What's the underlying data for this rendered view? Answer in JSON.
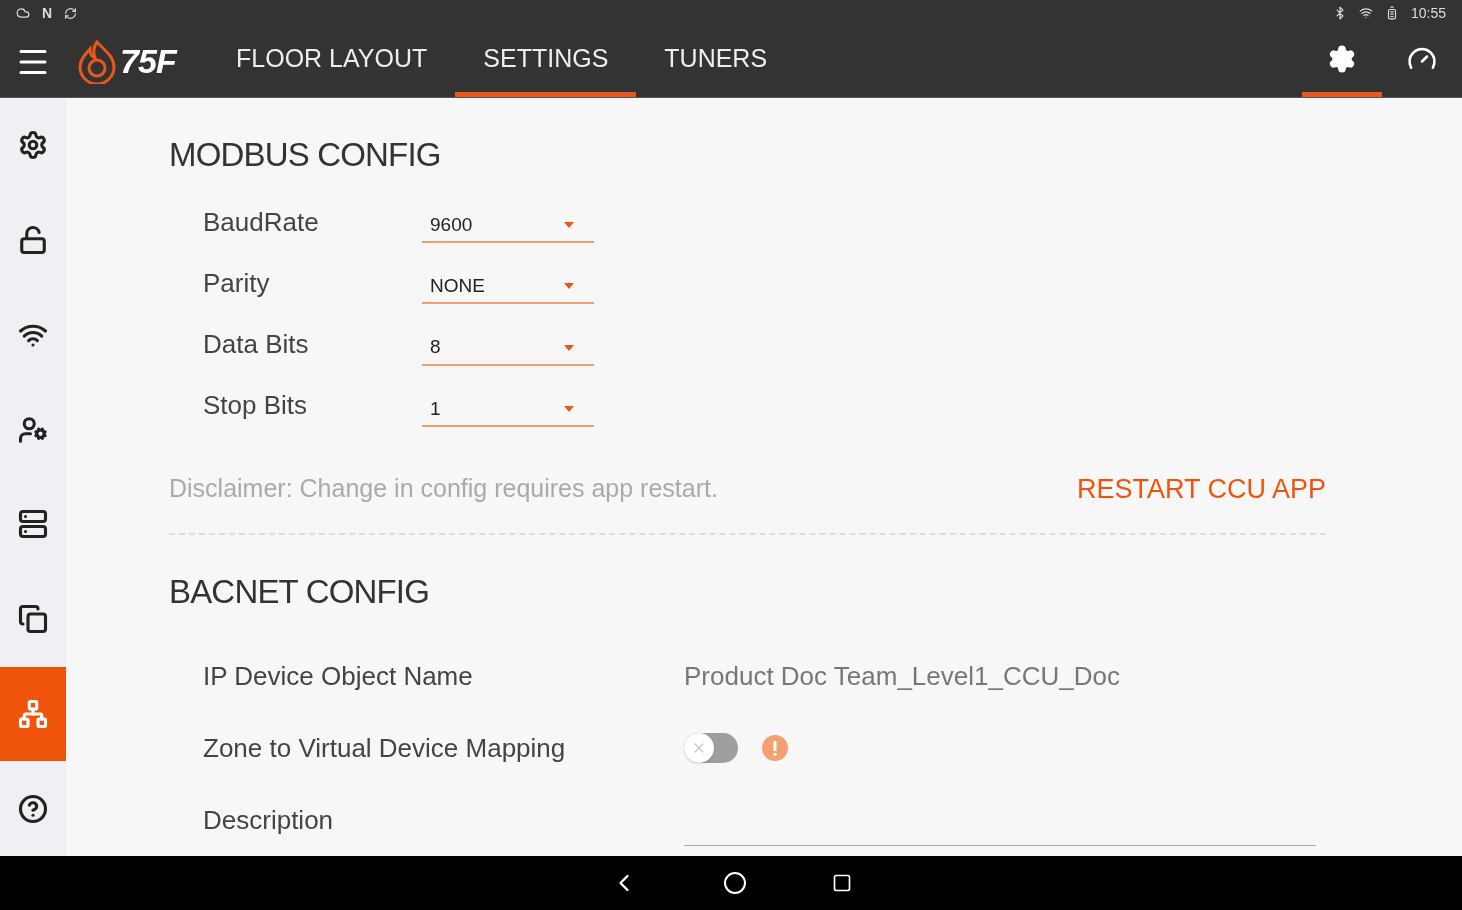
{
  "status_bar": {
    "glyph": "N",
    "time": "10:55"
  },
  "app_bar": {
    "logo_text": "75F",
    "tabs": [
      {
        "label": "FLOOR LAYOUT",
        "selected": false
      },
      {
        "label": "SETTINGS",
        "selected": true
      },
      {
        "label": "TUNERS",
        "selected": false
      }
    ],
    "actions": [
      {
        "kind": "settings",
        "selected": true
      },
      {
        "kind": "dashboard",
        "selected": false
      }
    ]
  },
  "sidebar": {
    "items": [
      {
        "kind": "settings",
        "selected": false
      },
      {
        "kind": "lock",
        "selected": false
      },
      {
        "kind": "wifi",
        "selected": false
      },
      {
        "kind": "user",
        "selected": false
      },
      {
        "kind": "server",
        "selected": false
      },
      {
        "kind": "copy",
        "selected": false
      },
      {
        "kind": "network",
        "selected": true
      },
      {
        "kind": "help",
        "selected": false
      }
    ]
  },
  "modbus": {
    "title": "MODBUS CONFIG",
    "fields": [
      {
        "label": "BaudRate",
        "value": "9600"
      },
      {
        "label": "Parity",
        "value": "NONE"
      },
      {
        "label": "Data Bits",
        "value": "8"
      },
      {
        "label": "Stop Bits",
        "value": "1"
      }
    ],
    "disclaimer": "Disclaimer: Change in config requires app restart.",
    "restart_button": "RESTART CCU APP"
  },
  "bacnet": {
    "title": "BACNET CONFIG",
    "rows": [
      {
        "kind": "text",
        "label": "IP Device Object Name",
        "value": "Product Doc Team_Level1_CCU_Doc"
      },
      {
        "kind": "toggle",
        "label": "Zone to Virtual Device Mapping",
        "on": false
      },
      {
        "kind": "input",
        "label": "Description"
      }
    ]
  }
}
